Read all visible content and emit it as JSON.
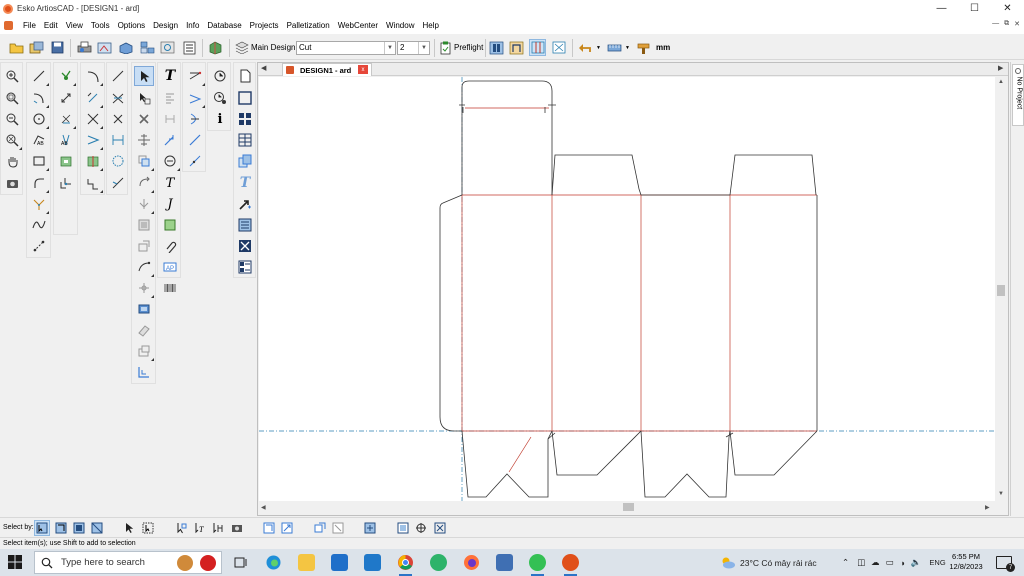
{
  "window": {
    "title": "Esko ArtiosCAD - [DESIGN1 - ard]",
    "controls": [
      "minimize",
      "maximize",
      "close"
    ]
  },
  "menu": {
    "items": [
      "File",
      "Edit",
      "View",
      "Tools",
      "Options",
      "Design",
      "Info",
      "Database",
      "Projects",
      "Palletization",
      "WebCenter",
      "Window",
      "Help"
    ]
  },
  "toolbar": {
    "main_design_label": "Main Design",
    "line_type_value": "Cut",
    "pointage_value": "2",
    "preflight_label": "Preflight",
    "units_label": "mm"
  },
  "document": {
    "tab_title": "DESIGN1 - ard",
    "tab_close": "x"
  },
  "side_panel": {
    "label": "No Project"
  },
  "select_bar": {
    "label": "Select by:"
  },
  "status": {
    "message": "Select item(s); use Shift to add to selection"
  },
  "taskbar": {
    "search_placeholder": "Type here to search",
    "weather": "23°C  Có mây rải rác",
    "language": "ENG",
    "time": "6:55 PM",
    "date": "12/8/2023",
    "notifications": "7"
  },
  "colors": {
    "cut_line": "#333333",
    "crease_line": "#c0392b",
    "guide_line": "#2a7fb0",
    "selected_tool": "#c8def5",
    "accent": "#e0501a"
  }
}
